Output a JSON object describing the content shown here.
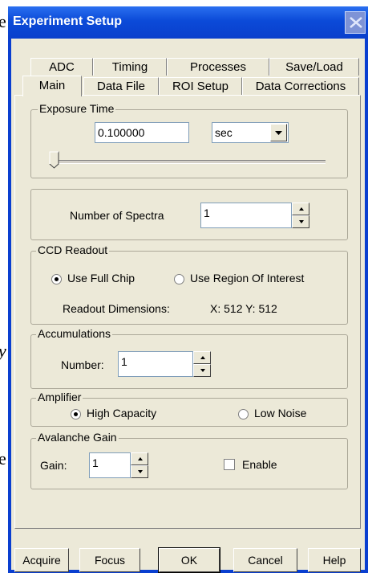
{
  "background_chars": [
    "e",
    "y",
    "e"
  ],
  "window": {
    "title": "Experiment Setup"
  },
  "tabs_row1": [
    "ADC",
    "Timing",
    "Processes",
    "Save/Load"
  ],
  "tabs_row2": [
    "Main",
    "Data File",
    "ROI Setup",
    "Data Corrections"
  ],
  "selected_tab": "Main",
  "exposure": {
    "legend": "Exposure Time",
    "value": "0.100000",
    "unit": "sec",
    "slider_fraction": 0.0
  },
  "spectra": {
    "label": "Number of Spectra",
    "value": "1"
  },
  "ccd_readout": {
    "legend": "CCD Readout",
    "options": [
      "Use Full Chip",
      "Use Region Of Interest"
    ],
    "selected": "Use Full Chip",
    "dims_label": "Readout Dimensions:",
    "dims_value": "X: 512  Y: 512"
  },
  "accumulations": {
    "legend": "Accumulations",
    "label": "Number:",
    "value": "1"
  },
  "amplifier": {
    "legend": "Amplifier",
    "options": [
      "High Capacity",
      "Low Noise"
    ],
    "selected": "High Capacity"
  },
  "avalanche": {
    "legend": "Avalanche Gain",
    "gain_label": "Gain:",
    "gain_value": "1",
    "enable_label": "Enable",
    "enable_checked": false
  },
  "buttons": {
    "acquire": "Acquire",
    "focus": "Focus",
    "ok": "OK",
    "cancel": "Cancel",
    "help": "Help"
  }
}
